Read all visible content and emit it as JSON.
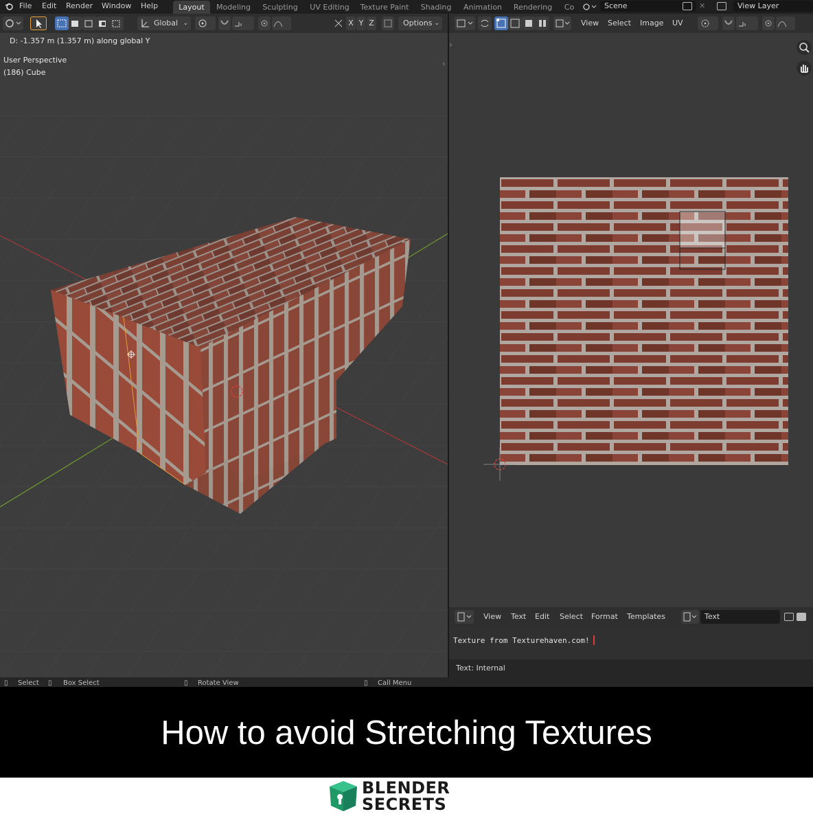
{
  "menu": {
    "items": [
      "File",
      "Edit",
      "Render",
      "Window",
      "Help"
    ],
    "workspaces": [
      "Layout",
      "Modeling",
      "Sculpting",
      "UV Editing",
      "Texture Paint",
      "Shading",
      "Animation",
      "Rendering",
      "Co"
    ],
    "active_workspace": "Layout",
    "scene": "Scene",
    "view_layer": "View Layer"
  },
  "viewport_header": {
    "orientation": "Global",
    "axes": [
      "X",
      "Y",
      "Z"
    ],
    "options": "Options"
  },
  "viewport": {
    "operator_info": "D: -1.357 m (1.357 m) along global Y",
    "view_name": "User Perspective",
    "object_info": "(186) Cube"
  },
  "uv_header": {
    "menus": [
      "View",
      "Select",
      "Image",
      "UV"
    ]
  },
  "text_editor": {
    "menus": [
      "View",
      "Text",
      "Edit",
      "Select",
      "Format",
      "Templates"
    ],
    "datablock": "Text",
    "content": "Texture from Texturehaven.com!",
    "footer": "Text: Internal"
  },
  "status_bar": {
    "items": [
      "Select",
      "Box Select",
      "Rotate View",
      "Call Menu"
    ]
  },
  "caption": "How to avoid Stretching Textures",
  "logo": {
    "line1": "BLENDER",
    "line2": "SECRETS"
  },
  "colors": {
    "brick": "#7a3e30",
    "mortar": "#9a918a",
    "accent": "#4772b3",
    "x_axis": "#b33a3a",
    "y_axis": "#6d9a2e",
    "logo_green": "#1f9a66"
  }
}
